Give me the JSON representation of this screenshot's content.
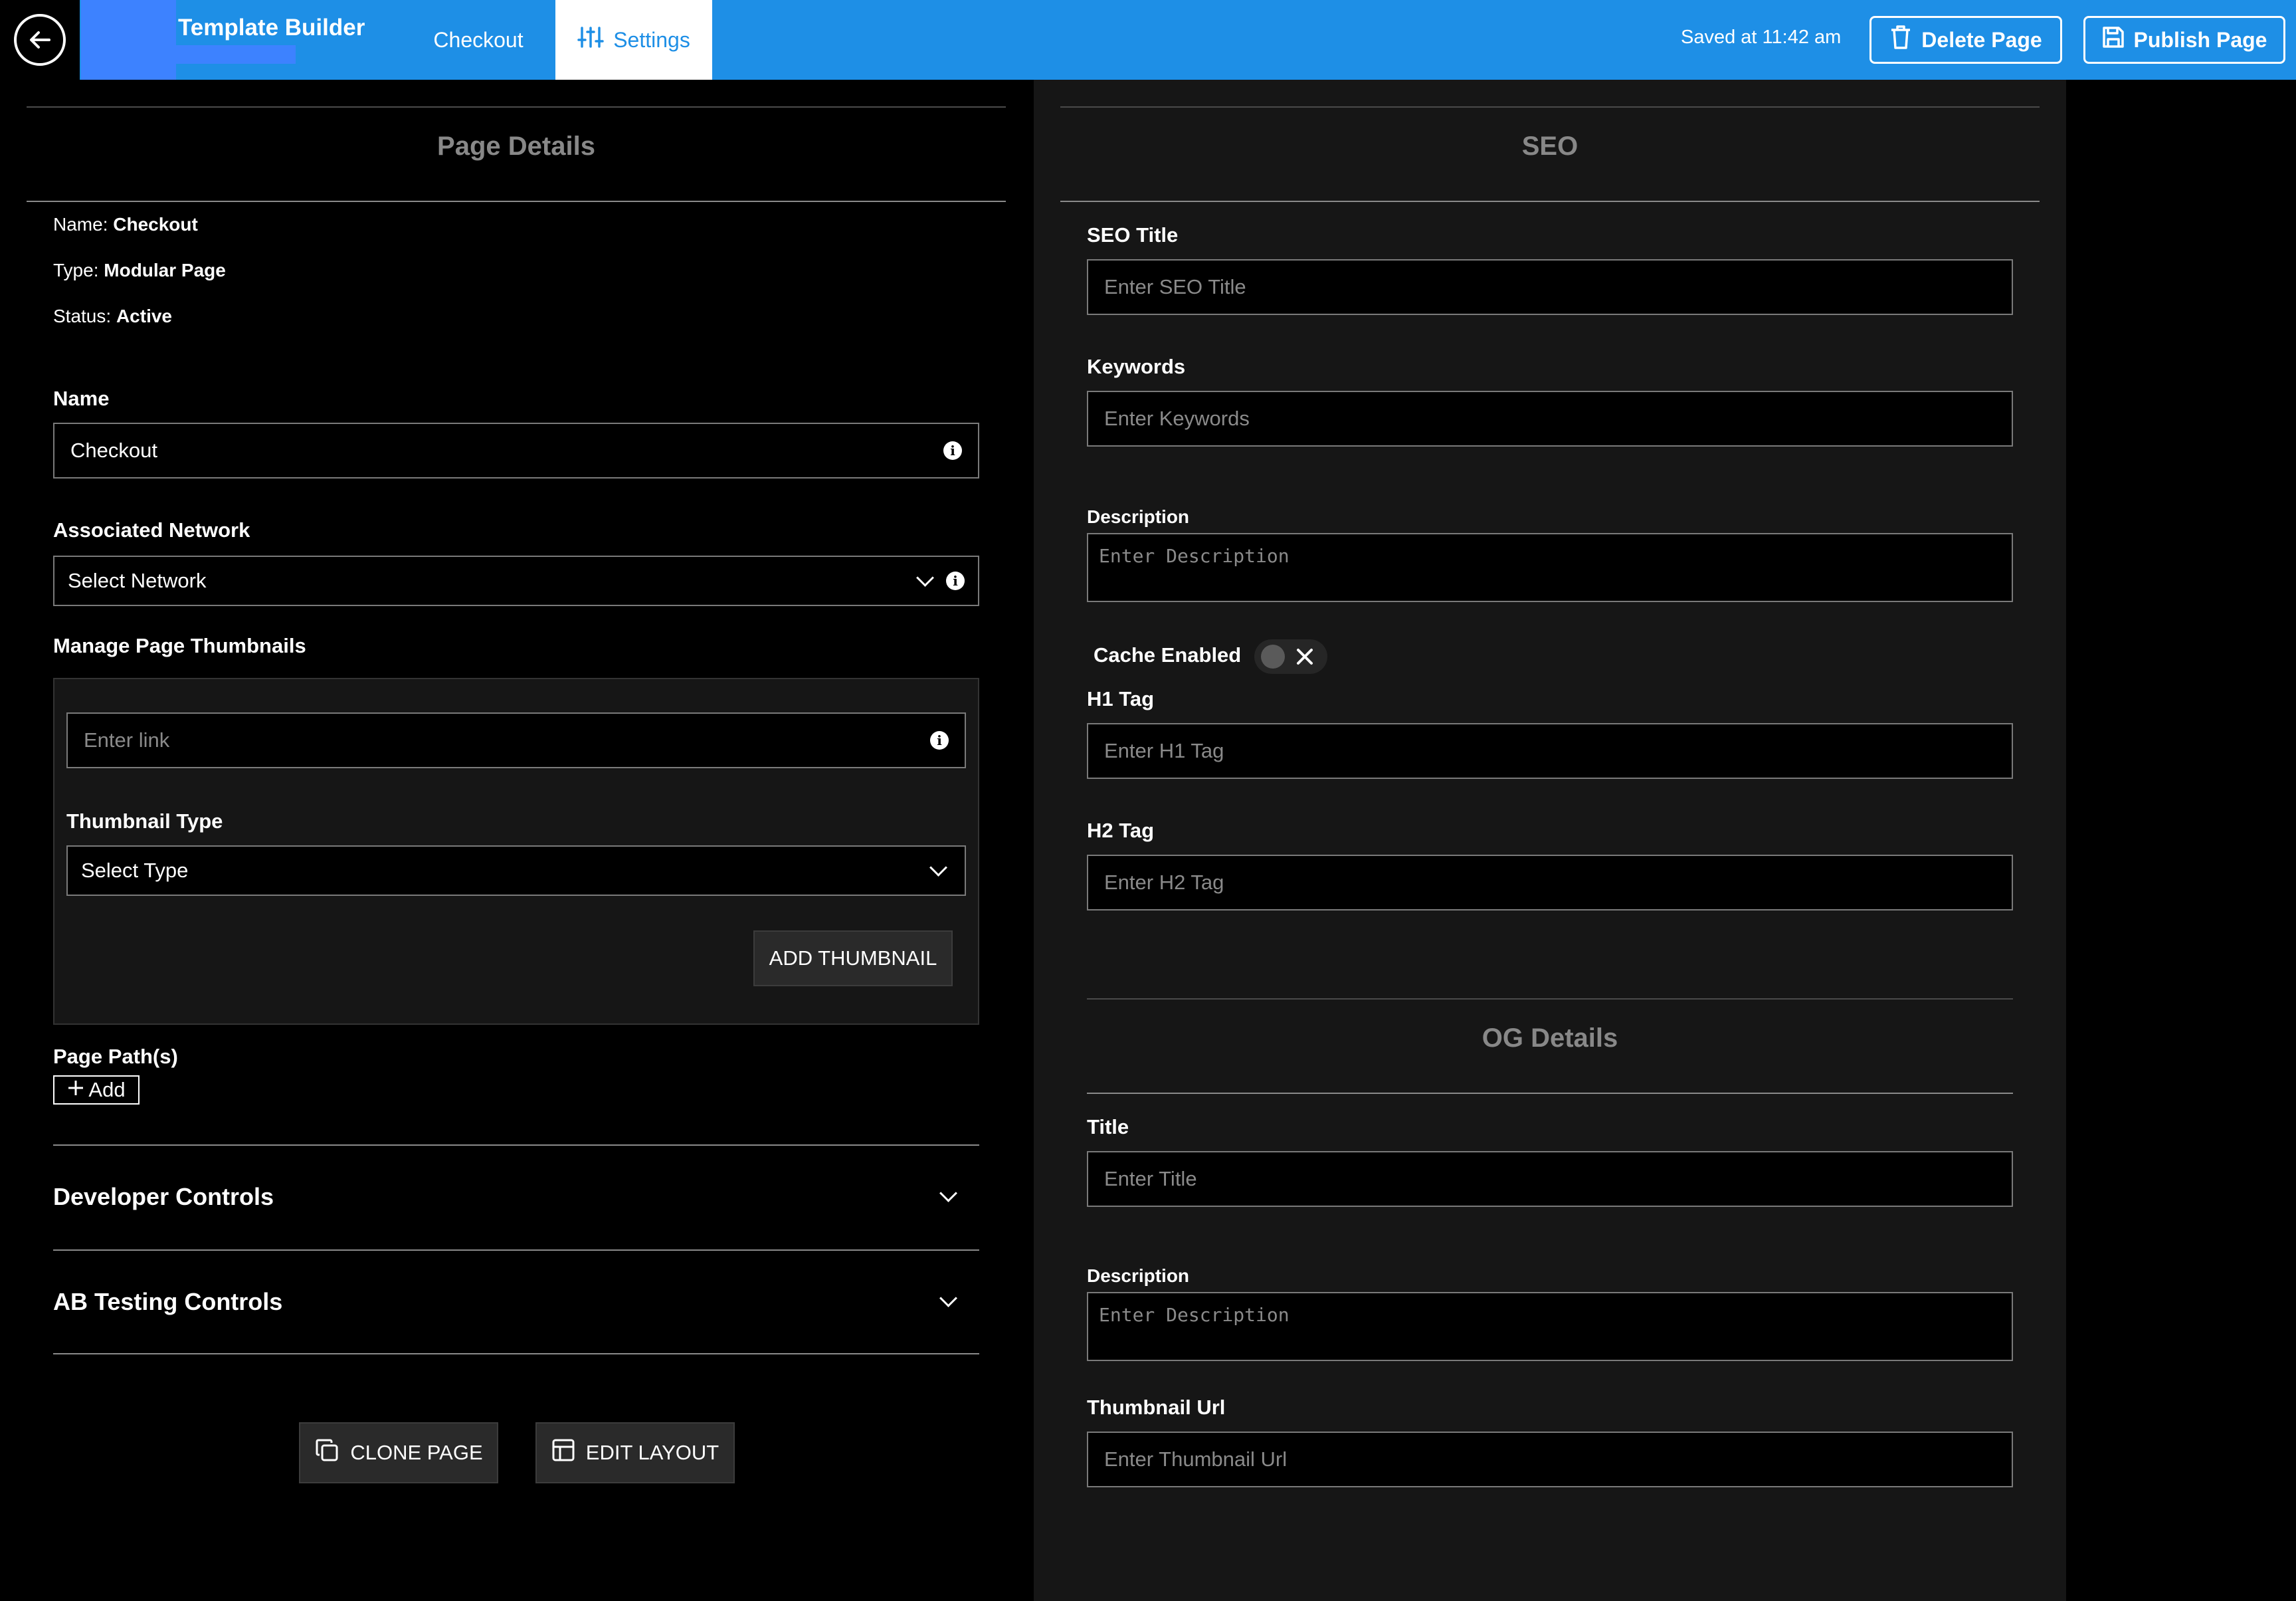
{
  "header": {
    "app_title": "Template Builder",
    "tabs": [
      {
        "label": "Checkout",
        "active": false
      },
      {
        "label": "Settings",
        "active": true
      }
    ],
    "saved_text": "Saved at 11:42 am",
    "delete_label": "Delete Page",
    "publish_label": "Publish Page"
  },
  "page_details": {
    "section_title": "Page Details",
    "info": [
      {
        "key": "Name:",
        "value": "Checkout"
      },
      {
        "key": "Type:",
        "value": "Modular Page"
      },
      {
        "key": "Status:",
        "value": "Active"
      }
    ],
    "name_label": "Name",
    "name_value": "Checkout",
    "network_label": "Associated Network",
    "network_value": "Select Network",
    "thumbnails_label": "Manage Page Thumbnails",
    "link_placeholder": "Enter link",
    "thumbnail_type_label": "Thumbnail Type",
    "thumbnail_type_value": "Select Type",
    "add_thumbnail_label": "ADD THUMBNAIL",
    "page_paths_label": "Page Path(s)",
    "add_label": "Add",
    "developer_controls_label": "Developer Controls",
    "ab_testing_label": "AB Testing Controls",
    "clone_label": "CLONE PAGE",
    "edit_layout_label": "EDIT LAYOUT"
  },
  "seo": {
    "section_title": "SEO",
    "seo_title_label": "SEO Title",
    "seo_title_placeholder": "Enter SEO Title",
    "keywords_label": "Keywords",
    "keywords_placeholder": "Enter Keywords",
    "description_label": "Description",
    "description_placeholder": "Enter Description",
    "cache_label": "Cache Enabled",
    "cache_enabled": false,
    "h1_label": "H1 Tag",
    "h1_placeholder": "Enter H1 Tag",
    "h2_label": "H2 Tag",
    "h2_placeholder": "Enter H2 Tag"
  },
  "og": {
    "section_title": "OG Details",
    "title_label": "Title",
    "title_placeholder": "Enter Title",
    "description_label": "Description",
    "description_placeholder": "Enter Description",
    "thumbnail_url_label": "Thumbnail Url",
    "thumbnail_url_placeholder": "Enter Thumbnail Url"
  },
  "colors": {
    "accent": "#1e8fe6",
    "brand_block": "#3d82ff",
    "panel_dark": "#161616"
  }
}
